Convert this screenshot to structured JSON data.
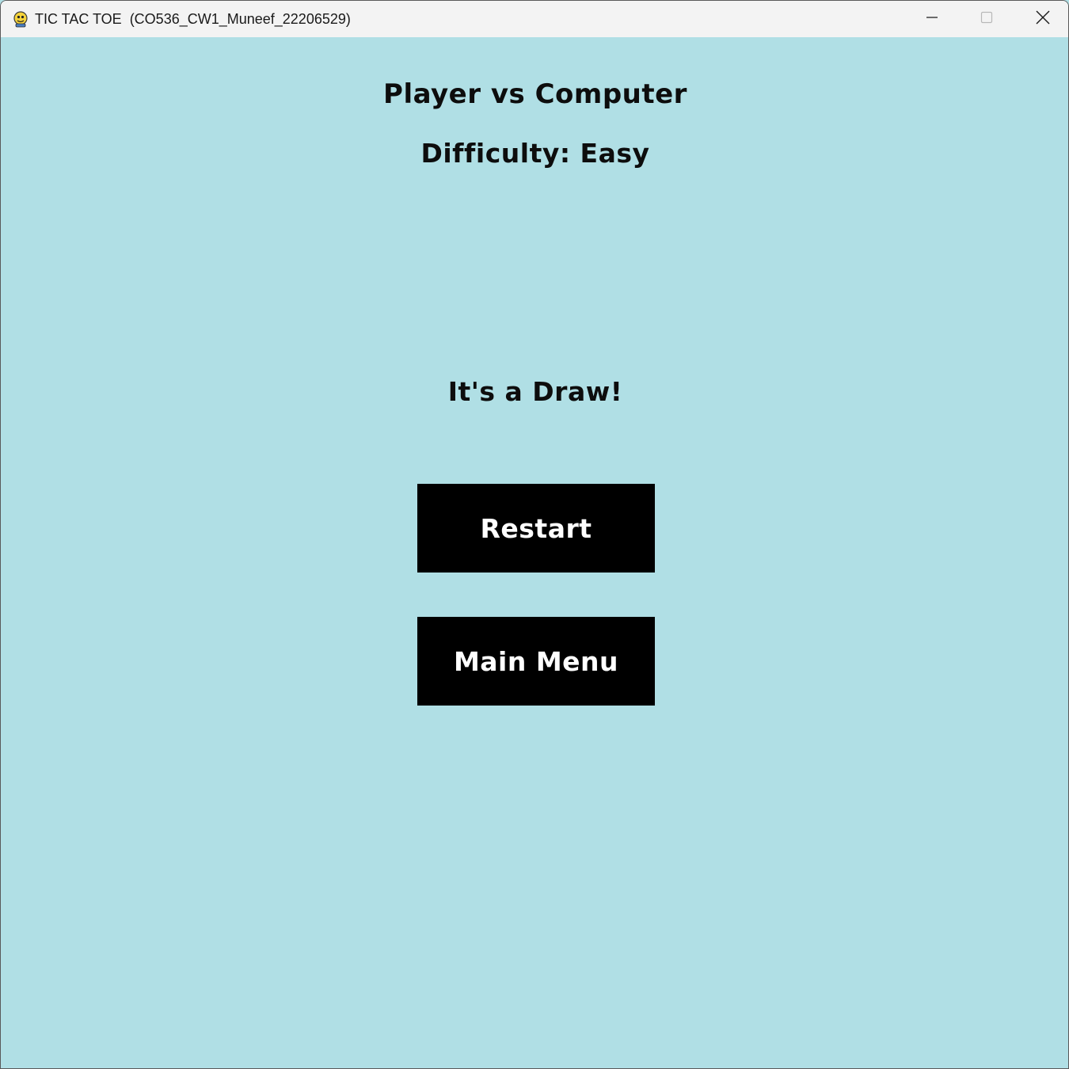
{
  "window": {
    "title": "TIC TAC TOE  (CO536_CW1_Muneef_22206529)",
    "controls": {
      "minimize_icon": "minimize-icon",
      "maximize_icon": "maximize-icon",
      "close_icon": "close-icon"
    }
  },
  "game": {
    "mode_title": "Player vs Computer",
    "difficulty": "Difficulty: Easy",
    "result": "It's a Draw!",
    "restart_label": "Restart",
    "main_menu_label": "Main Menu"
  },
  "colors": {
    "background": "#b0dfe5",
    "button_bg": "#000000",
    "button_text": "#ffffff",
    "text": "#0d0d0d"
  }
}
